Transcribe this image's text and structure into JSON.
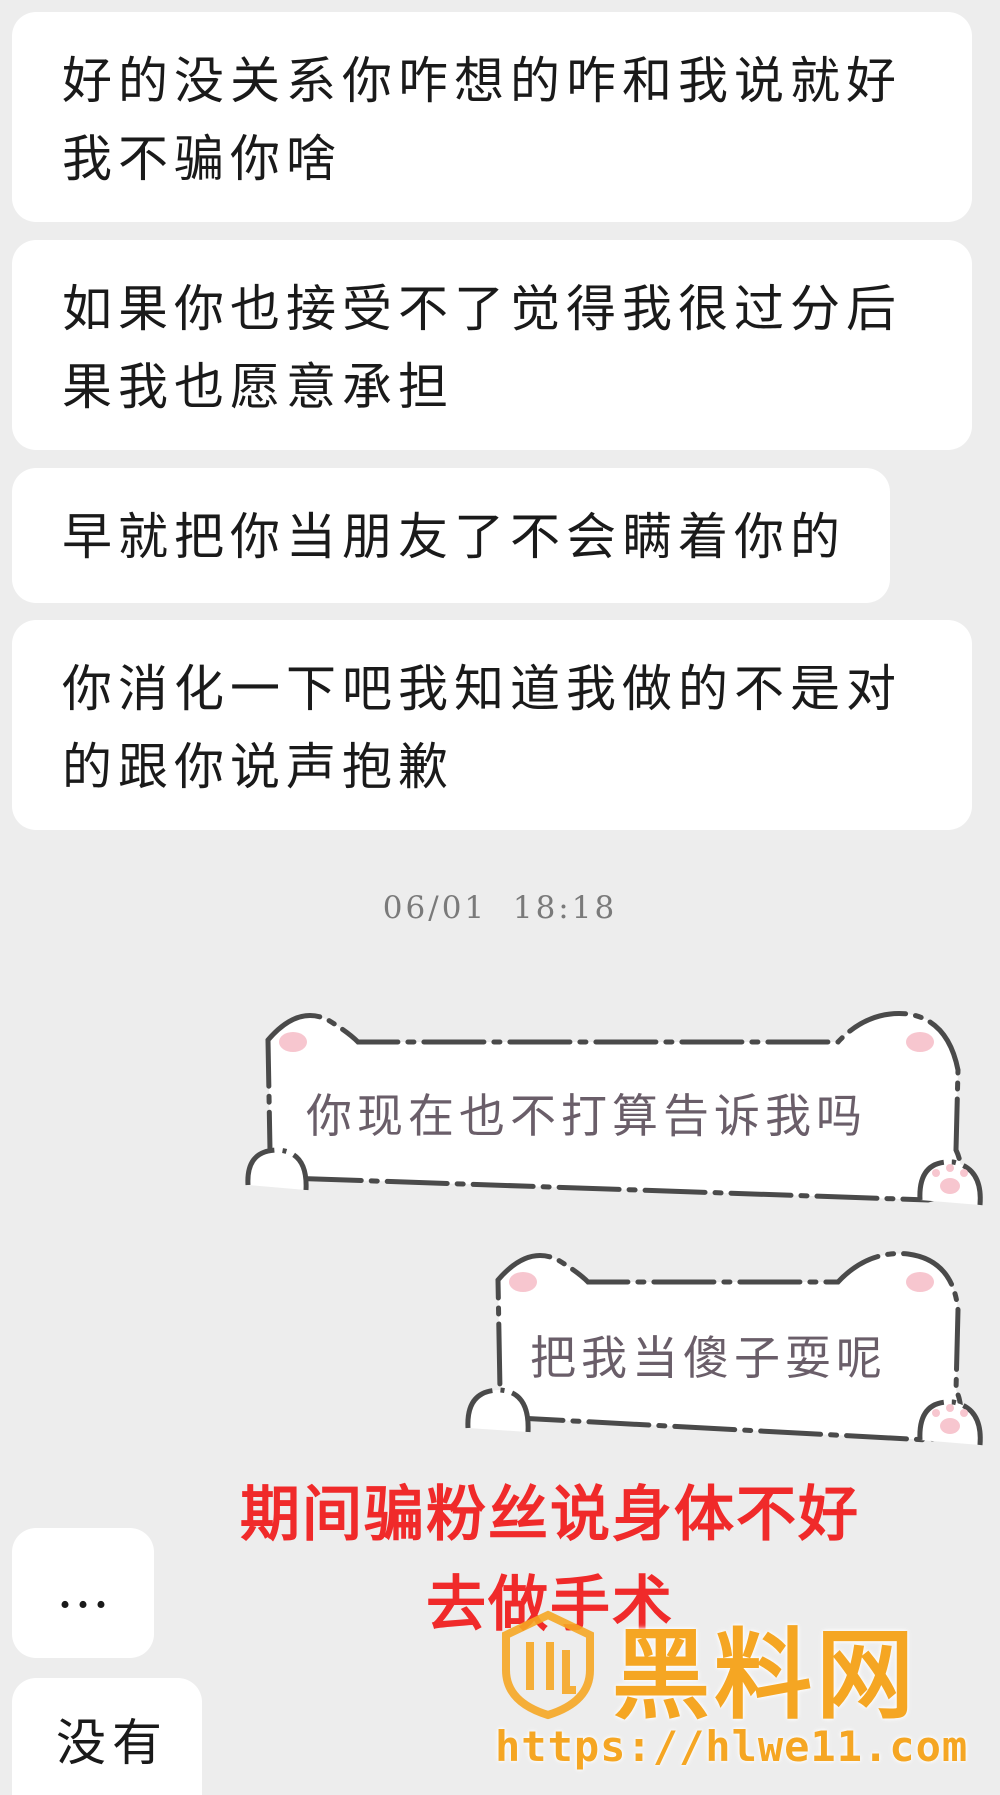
{
  "messages_incoming": [
    {
      "text": "好的没关系你咋想的咋和我说就好我不骗你啥"
    },
    {
      "text": "如果你也接受不了觉得我很过分后果我也愿意承担"
    },
    {
      "text": "早就把你当朋友了不会瞒着你的"
    },
    {
      "text": "你消化一下吧我知道我做的不是对的跟你说声抱歉"
    }
  ],
  "timestamp": "06/01  18:18",
  "messages_outgoing": [
    {
      "text": "你现在也不打算告诉我吗"
    },
    {
      "text": "把我当傻子耍呢"
    }
  ],
  "messages_incoming_2": [
    {
      "text": "…"
    },
    {
      "text": "没有"
    }
  ],
  "overlay_caption": "期间骗粉丝说身体不好去做手术",
  "watermark": {
    "name": "黑料网",
    "url": "https://hlwe11.com",
    "color": "#f5a623"
  },
  "colors": {
    "background": "#ededed",
    "bubble_in": "#ffffff",
    "caption_red": "#f02a2a",
    "cat_outline": "#4a4a4a",
    "cat_pink": "#f7c6cf"
  },
  "icons": [
    "cat-ear-icon",
    "cat-paw-icon",
    "watermark-logo-icon"
  ]
}
